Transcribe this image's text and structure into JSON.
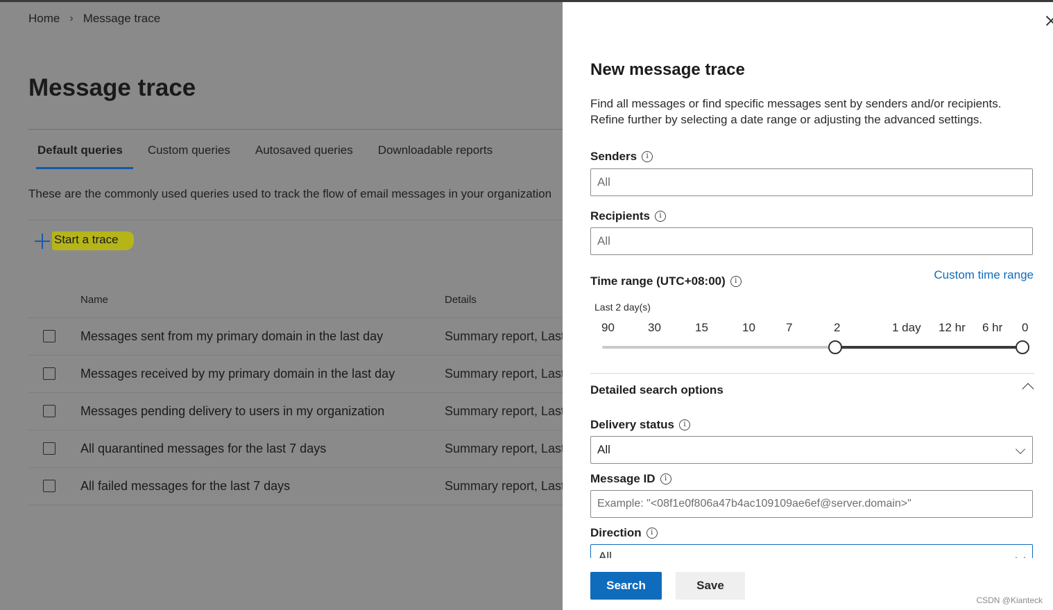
{
  "breadcrumb": {
    "home": "Home",
    "separator": "›",
    "current": "Message trace"
  },
  "page": {
    "title": "Message trace",
    "tabs": [
      {
        "label": "Default queries",
        "active": true
      },
      {
        "label": "Custom queries"
      },
      {
        "label": "Autosaved queries"
      },
      {
        "label": "Downloadable reports"
      }
    ],
    "description": "These are the commonly used queries used to track the flow of email messages in your organization",
    "start_trace_label": "Start a trace",
    "highlight_color": "#b5b51a",
    "columns": {
      "name": "Name",
      "details": "Details"
    },
    "rows": [
      {
        "name": "Messages sent from my primary domain in the last day",
        "details": "Summary report, Last"
      },
      {
        "name": "Messages received by my primary domain in the last day",
        "details": "Summary report, Last"
      },
      {
        "name": "Messages pending delivery to users in my organization",
        "details": "Summary report, Last"
      },
      {
        "name": "All quarantined messages for the last 7 days",
        "details": "Summary report, Last"
      },
      {
        "name": "All failed messages for the last 7 days",
        "details": "Summary report, Last"
      }
    ]
  },
  "panel": {
    "title": "New message trace",
    "description": "Find all messages or find specific messages sent by senders and/or recipients. Refine further by selecting a date range or adjusting the advanced settings.",
    "senders": {
      "label": "Senders",
      "placeholder": "All"
    },
    "recipients": {
      "label": "Recipients",
      "placeholder": "All"
    },
    "time_range": {
      "label": "Time range (UTC+08:00)",
      "custom_link": "Custom time range",
      "selection_text": "Last 2 day(s)",
      "ticks": [
        "90",
        "30",
        "15",
        "10",
        "7",
        "2",
        "1 day",
        "12 hr",
        "6 hr",
        "0"
      ],
      "selected_start_tick": "2",
      "selected_end_tick": "0"
    },
    "detailed_search": {
      "label": "Detailed search options",
      "expanded": true
    },
    "delivery_status": {
      "label": "Delivery status",
      "value": "All"
    },
    "message_id": {
      "label": "Message ID",
      "placeholder": "Example: \"<08f1e0f806a47b4ac109109ae6ef@server.domain>\""
    },
    "direction": {
      "label": "Direction",
      "value": "All"
    },
    "buttons": {
      "search": "Search",
      "save": "Save"
    },
    "accent_color": "#0f6cbd"
  },
  "watermark": "CSDN @Kianteck"
}
